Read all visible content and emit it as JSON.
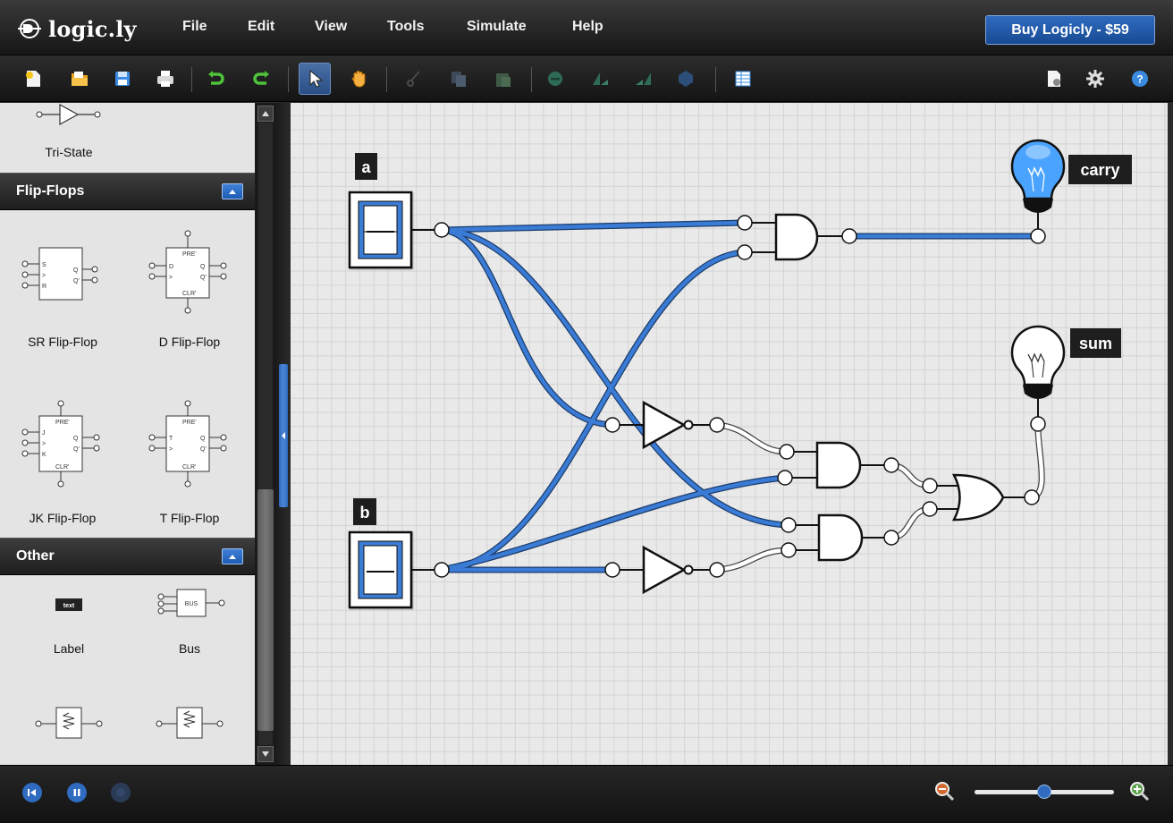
{
  "app": {
    "logo_text": "logic.ly",
    "buy_label": "Buy Logicly - $59"
  },
  "menu": {
    "items": [
      {
        "label": "File"
      },
      {
        "label": "Edit"
      },
      {
        "label": "View"
      },
      {
        "label": "Tools"
      },
      {
        "label": "Simulate"
      },
      {
        "label": "Help"
      }
    ]
  },
  "toolbar": {
    "buttons": [
      "new-icon",
      "open-icon",
      "save-icon",
      "print-icon",
      "undo-icon",
      "redo-icon",
      "select-pointer-icon",
      "pan-hand-icon",
      "cut-icon",
      "copy-icon",
      "paste-icon",
      "delete-icon",
      "flip-horizontal-icon",
      "flip-vertical-icon",
      "rotate-icon",
      "truth-table-icon",
      "document-settings-icon",
      "settings-gear-icon",
      "help-icon"
    ]
  },
  "sidebar": {
    "top_component": {
      "label": "Tri-State"
    },
    "sections": [
      {
        "title": "Flip-Flops",
        "components": [
          {
            "label": "SR Flip-Flop"
          },
          {
            "label": "D Flip-Flop"
          },
          {
            "label": "JK Flip-Flop"
          },
          {
            "label": "T Flip-Flop"
          }
        ]
      },
      {
        "title": "Other",
        "components": [
          {
            "label": "Label",
            "icon_text": "text"
          },
          {
            "label": "Bus",
            "icon_text": "BUS"
          }
        ]
      }
    ],
    "flipflop_pins": {
      "sr": [
        "S",
        ">",
        "R",
        "Q",
        "Q'"
      ],
      "d": [
        "PRE'",
        "D",
        ">",
        "CLR'",
        "Q",
        "Q'"
      ],
      "jk": [
        "PRE'",
        "J",
        ">",
        "K",
        "CLR'",
        "Q",
        "Q'"
      ],
      "t": [
        "PRE'",
        "T",
        ">",
        "CLR'",
        "Q",
        "Q'"
      ]
    }
  },
  "circuit": {
    "inputs": [
      {
        "label": "a",
        "state": "on"
      },
      {
        "label": "b",
        "state": "on"
      }
    ],
    "outputs": [
      {
        "label": "carry",
        "state": "on"
      },
      {
        "label": "sum",
        "state": "off"
      }
    ],
    "gates": [
      "AND",
      "NOT",
      "NOT",
      "AND",
      "AND",
      "OR"
    ],
    "colors": {
      "wire_on": "#3a7bd5",
      "wire_off": "#ffffff",
      "bulb_on": "#4aa3ff",
      "accent": "#2a64b8"
    }
  },
  "statusbar": {
    "buttons": [
      "reset-icon",
      "pause-icon",
      "step-icon"
    ],
    "zoom": {
      "level": 0.5
    }
  }
}
